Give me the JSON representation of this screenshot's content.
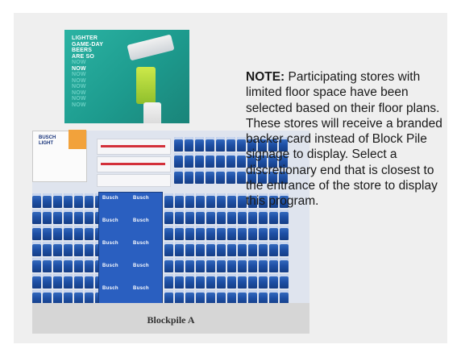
{
  "ad": {
    "line1": "LIGHTER",
    "line2": "GAME-DAY",
    "line3": "BEERS",
    "line4": "ARE SO",
    "line5": "NOW",
    "line6": "NOW",
    "line7": "NOW",
    "line8": "NOW",
    "line9": "NOW",
    "line10": "NOW",
    "line11": "NOW",
    "line12": "NOW"
  },
  "display": {
    "label": "Blockpile A"
  },
  "note": {
    "label": "NOTE:",
    "body": "Participating stores with limited floor space have been selected based on their floor plans. These stores will receive a branded backer card instead of Block Pile signage to display. Select a discretionary end that is closest to the entrance of the store to display this program."
  },
  "colors": {
    "panel_bg": "#efefef",
    "ad_teal": "#1d9b8e",
    "can_blue": "#1e4fa4"
  }
}
